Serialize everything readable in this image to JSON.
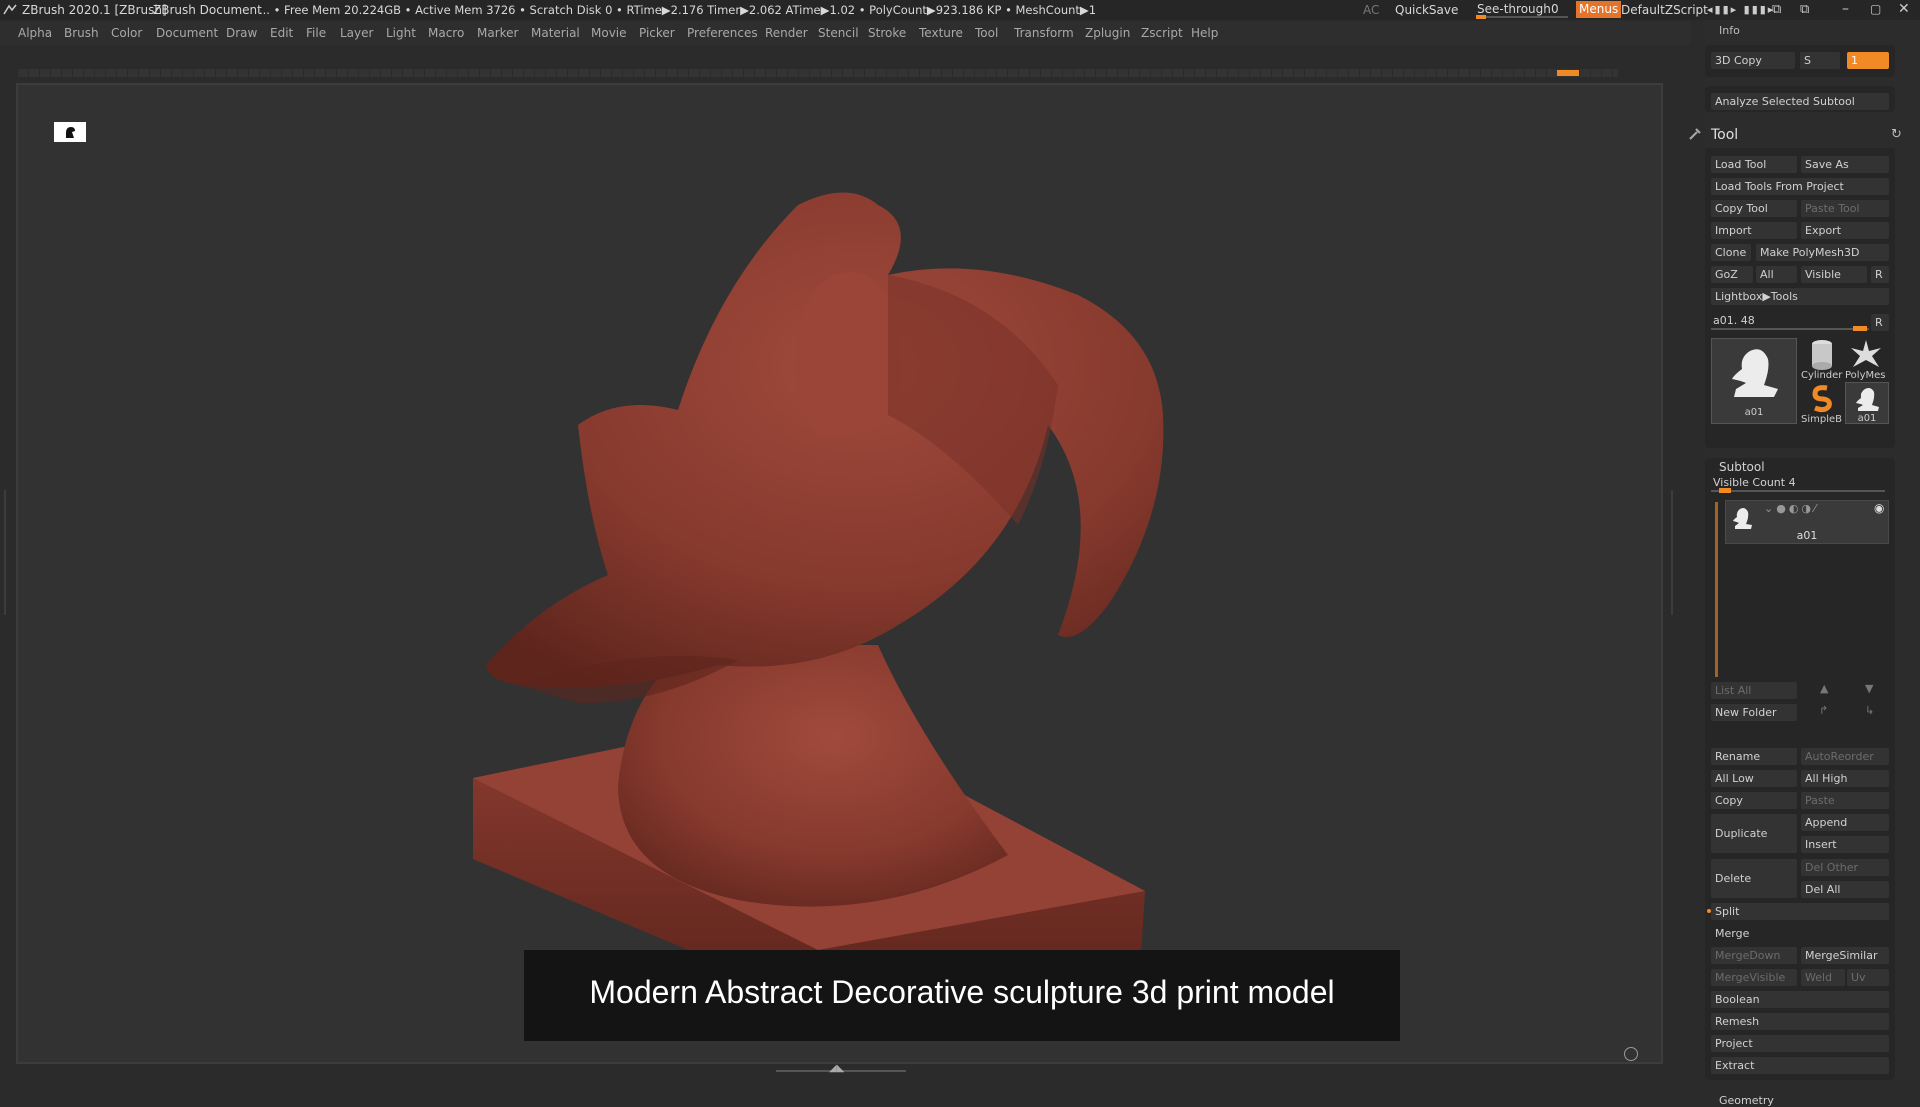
{
  "titlebar": {
    "app_title": "ZBrush 2020.1 [ZBrush]",
    "document": "ZBrush Document",
    "stats": "... • Free Mem 20.224GB • Active Mem 3726 • Scratch Disk 0 •  RTime▶2.176 Timer▶2.062 ATime▶1.02 • PolyCount▶923.186 KP  • MeshCount▶1",
    "ac": "AC",
    "quicksave": "QuickSave",
    "seethrough_label": "See-through",
    "seethrough_value": "0",
    "menus": "Menus",
    "zscript": "DefaultZScript"
  },
  "menubar": {
    "items": [
      "Alpha",
      "Brush",
      "Color",
      "Document",
      "Draw",
      "Edit",
      "File",
      "Layer",
      "Light",
      "Macro",
      "Marker",
      "Material",
      "Movie",
      "Picker",
      "Preferences",
      "Render",
      "Stencil",
      "Stroke",
      "Texture",
      "Tool",
      "Transform",
      "Zplugin",
      "Zscript",
      "Help"
    ]
  },
  "panel": {
    "info": "Info",
    "copy3d": "3D Copy",
    "copy3d_s": "S",
    "copy3d_field": "1",
    "analyze": "Analyze Selected Subtool",
    "tool_title": "Tool",
    "tool_buttons": {
      "load_tool": "Load Tool",
      "save_as": "Save As",
      "load_from_project": "Load Tools From Project",
      "copy_tool": "Copy Tool",
      "paste_tool": "Paste Tool",
      "import": "Import",
      "export": "Export",
      "clone": "Clone",
      "make_polymesh": "Make PolyMesh3D",
      "goz": "GoZ",
      "all": "All",
      "visible": "Visible",
      "r": "R",
      "lightbox_tools": "Lightbox▶Tools"
    },
    "current_tool": "a01. 48",
    "current_tool_r": "R",
    "thumbs": [
      {
        "label": "a01"
      },
      {
        "label": "Cylinder"
      },
      {
        "label": "PolyMes"
      },
      {
        "label": "SimpleB"
      },
      {
        "label": "a01"
      }
    ],
    "subtool": {
      "title": "Subtool",
      "visible_count": "Visible Count 4",
      "item_name": "a01",
      "list_all": "List All",
      "new_folder": "New Folder",
      "rename": "Rename",
      "autoreorder": "AutoReorder",
      "all_low": "All Low",
      "all_high": "All High",
      "copy": "Copy",
      "paste": "Paste",
      "duplicate": "Duplicate",
      "append": "Append",
      "insert": "Insert",
      "delete": "Delete",
      "del_other": "Del Other",
      "del_all": "Del All",
      "split": "Split",
      "merge": "Merge",
      "mergedown": "MergeDown",
      "mergesimilar": "MergeSimilar",
      "mergevisible": "MergeVisible",
      "weld": "Weld",
      "uv": "Uv",
      "boolean": "Boolean",
      "remesh": "Remesh",
      "project": "Project",
      "extract": "Extract",
      "geometry": "Geometry"
    }
  },
  "caption": "Modern Abstract Decorative sculpture 3d print model",
  "colors": {
    "accent": "#f08a24",
    "sculpt": "#8a3a2e",
    "bg": "#2b2b2b"
  },
  "icons": {
    "viewport_corner": "person-icon",
    "tool_header": "brush-icon",
    "refresh": "refresh-icon"
  }
}
